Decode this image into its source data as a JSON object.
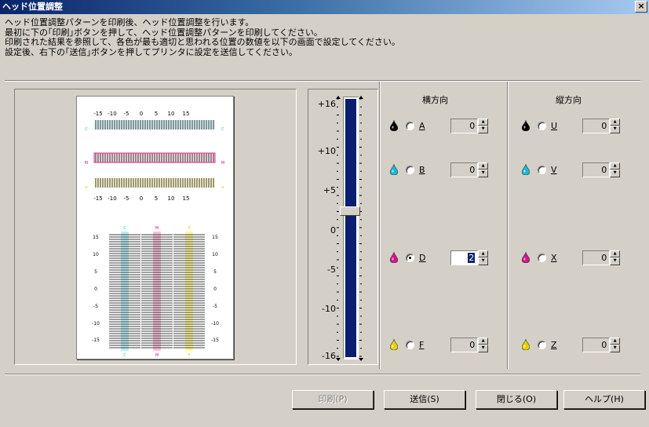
{
  "window": {
    "title": "ヘッド位置調整",
    "close": "×"
  },
  "instructions": [
    "ヘッド位置調整パターンを印刷後、ヘッド位置調整を行います。",
    "最初に下の｢印刷｣ボタンを押して、ヘッド位置調整パターンを印刷してください。",
    "印刷された結果を参照して、各色が最も適切と思われる位置の数値を以下の画面で設定してください。",
    "設定後、右下の｢送信｣ボタンを押してプリンタに設定を送信してください。"
  ],
  "pattern": {
    "top_scale": [
      "-15",
      "-10",
      "-5",
      "0",
      "5",
      "10",
      "15"
    ],
    "bottom_scale": [
      "-15",
      "-10",
      "-5",
      "0",
      "5",
      "10",
      "15"
    ],
    "letters": {
      "c": "C",
      "m": "M",
      "y": "Y"
    },
    "vert_scale": [
      "15",
      "10",
      "5",
      "0",
      "-5",
      "-10",
      "-15"
    ]
  },
  "scale": {
    "labels": [
      "+16",
      "+10",
      "+5",
      "0",
      "-5",
      "-10",
      "-16"
    ],
    "value": 2
  },
  "horizontal": {
    "header": "横方向",
    "rows": [
      {
        "label": "A",
        "value": "0",
        "selected": false,
        "color": "#000000"
      },
      {
        "label": "B",
        "value": "0",
        "selected": false,
        "color": "#1bb8d8"
      },
      {
        "label": "D",
        "value": "2",
        "selected": true,
        "color": "#d0168c"
      },
      {
        "label": "F",
        "value": "0",
        "selected": false,
        "color": "#e8d000"
      }
    ]
  },
  "vertical": {
    "header": "縦方向",
    "rows": [
      {
        "label": "U",
        "value": "0",
        "selected": false,
        "color": "#000000"
      },
      {
        "label": "V",
        "value": "0",
        "selected": false,
        "color": "#1bb8d8"
      },
      {
        "label": "X",
        "value": "0",
        "selected": false,
        "color": "#d0168c"
      },
      {
        "label": "Z",
        "value": "0",
        "selected": false,
        "color": "#e8d000"
      }
    ]
  },
  "buttons": {
    "print": "印刷(P)",
    "send": "送信(S)",
    "close": "閉じる(O)",
    "help": "ヘルプ(H)"
  }
}
